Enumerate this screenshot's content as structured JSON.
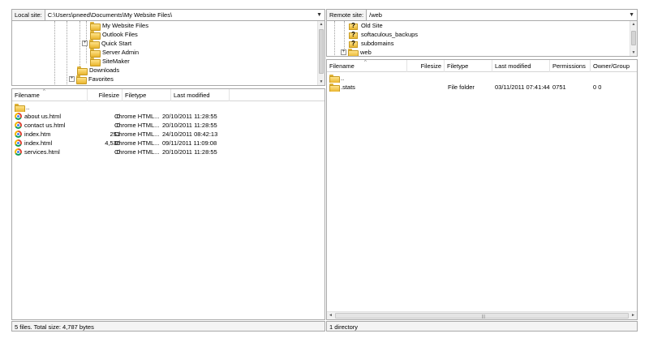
{
  "local": {
    "site_label": "Local site:",
    "path": "C:\\Users\\pneed\\Documents\\My Website Files\\",
    "tree": [
      {
        "label": "My Website Files",
        "expandable": false
      },
      {
        "label": "Outlook Files",
        "expandable": false
      },
      {
        "label": "Quick Start",
        "expandable": true
      },
      {
        "label": "Server Admin",
        "expandable": false
      },
      {
        "label": "SiteMaker",
        "expandable": false
      },
      {
        "label": "Downloads",
        "expandable": false
      },
      {
        "label": "Favorites",
        "expandable": true
      }
    ],
    "columns": [
      "Filename",
      "Filesize",
      "Filetype",
      "Last modified"
    ],
    "files": [
      {
        "name": "..",
        "size": "",
        "type": "",
        "modified": "",
        "icon": "folder-icon"
      },
      {
        "name": "about us.html",
        "size": "0",
        "type": "Chrome HTML...",
        "modified": "20/10/2011 11:28:55",
        "icon": "chrome-html-icon"
      },
      {
        "name": "contact us.html",
        "size": "0",
        "type": "Chrome HTML...",
        "modified": "20/10/2011 11:28:55",
        "icon": "chrome-html-icon"
      },
      {
        "name": "index.htm",
        "size": "251",
        "type": "Chrome HTML...",
        "modified": "24/10/2011 08:42:13",
        "icon": "chrome-html-icon"
      },
      {
        "name": "index.html",
        "size": "4,536",
        "type": "Chrome HTML...",
        "modified": "09/11/2011 11:09:08",
        "icon": "chrome-html-icon"
      },
      {
        "name": "services.html",
        "size": "0",
        "type": "Chrome HTML...",
        "modified": "20/10/2011 11:28:55",
        "icon": "chrome-html-icon"
      }
    ],
    "status": "5 files. Total size: 4,787 bytes"
  },
  "remote": {
    "site_label": "Remote site:",
    "path": "/web",
    "tree": [
      {
        "label": "Old Site",
        "expandable": false,
        "icon": "unknown-folder-icon"
      },
      {
        "label": "softaculous_backups",
        "expandable": false,
        "icon": "unknown-folder-icon"
      },
      {
        "label": "subdomains",
        "expandable": false,
        "icon": "unknown-folder-icon"
      },
      {
        "label": "web",
        "expandable": true,
        "icon": "folder-icon"
      }
    ],
    "columns": [
      "Filename",
      "Filesize",
      "Filetype",
      "Last modified",
      "Permissions",
      "Owner/Group"
    ],
    "files": [
      {
        "name": "..",
        "size": "",
        "type": "",
        "modified": "",
        "permissions": "",
        "owner": "",
        "icon": "folder-icon"
      },
      {
        "name": ".stats",
        "size": "",
        "type": "File folder",
        "modified": "03/11/2011 07:41:44",
        "permissions": "0751",
        "owner": "0 0",
        "icon": "folder-icon"
      }
    ],
    "status": "1 directory"
  },
  "colors": {
    "border": "#a9a9a9",
    "folder": "#e9b52f",
    "background": "#ffffff"
  }
}
